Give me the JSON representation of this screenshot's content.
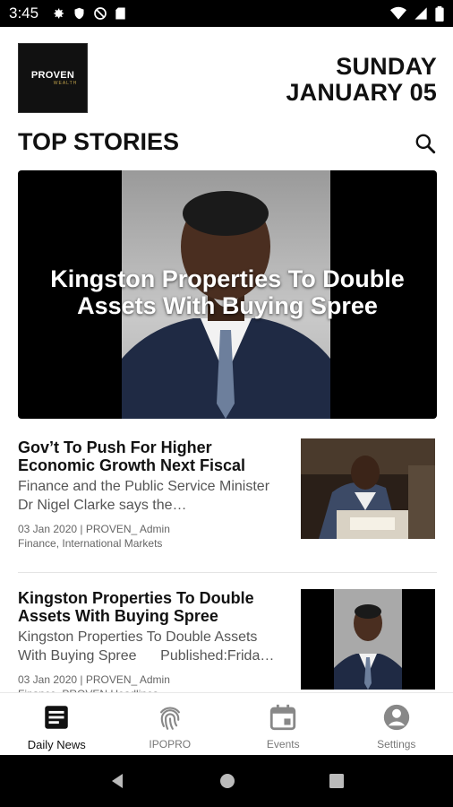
{
  "status_bar": {
    "time": "3:45"
  },
  "header": {
    "logo_text": "PROVEN",
    "logo_sub": "WEALTH",
    "date_line1": "SUNDAY",
    "date_line2": "JANUARY 05"
  },
  "section": {
    "title": "TOP STORIES"
  },
  "hero": {
    "title": "Kingston Properties To Double Assets With Buying Spree"
  },
  "articles": [
    {
      "title": "Gov’t To Push For Higher Economic Growth Next Fiscal",
      "summary": "Finance and the Public Service Minister Dr Nigel Clarke says the…",
      "meta": "03 Jan 2020 | PROVEN_ Admin",
      "tags": "Finance, International Markets"
    },
    {
      "title": "Kingston Properties To Double Assets With Buying Spree",
      "summary": "Kingston Properties To Double Assets With Buying Spree      Published:Frida…",
      "meta": "03 Jan 2020 | PROVEN_ Admin",
      "tags": "Finance, PROVEN Headlines"
    }
  ],
  "bottom_nav": [
    {
      "label": "Daily News",
      "icon": "newspaper-icon",
      "active": true
    },
    {
      "label": "IPOPRO",
      "icon": "fingerprint-icon",
      "active": false
    },
    {
      "label": "Events",
      "icon": "calendar-icon",
      "active": false
    },
    {
      "label": "Settings",
      "icon": "account-circle-icon",
      "active": false
    }
  ],
  "colors": {
    "accent": "#111111",
    "inactive": "#777777",
    "status_bar": "#000000",
    "logo_gold": "#bfa14a"
  }
}
